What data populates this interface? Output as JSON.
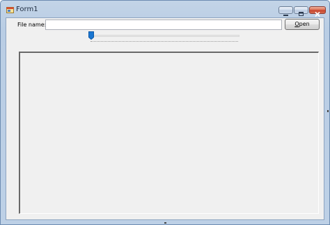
{
  "window": {
    "title": "Form1",
    "icon": "app-form-icon"
  },
  "caption_buttons": {
    "minimize": "minimize-icon",
    "maximize": "maximize-icon",
    "close": "close-icon"
  },
  "file_row": {
    "label": "File name:",
    "input_value": "",
    "open_button": {
      "mnemonic": "O",
      "rest": "pen"
    }
  },
  "slider": {
    "value_fraction": 0.0
  },
  "colors": {
    "title_bar": "#c3d4e7",
    "client_background": "#f0f0f0",
    "slider_thumb": "#1a76d2"
  }
}
